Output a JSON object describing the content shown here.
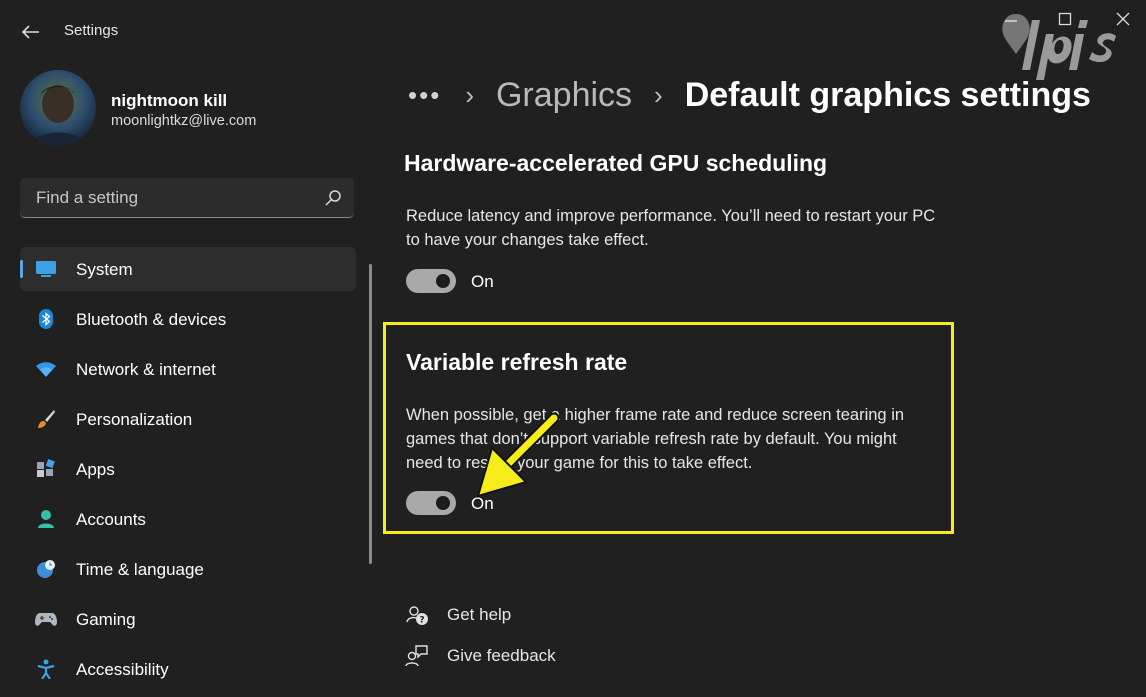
{
  "window": {
    "title": "Settings"
  },
  "profile": {
    "name": "nightmoon kill",
    "email": "moonlightkz@live.com"
  },
  "search": {
    "placeholder": "Find a setting"
  },
  "sidebar": {
    "items": [
      {
        "label": "System",
        "icon": "system-icon",
        "selected": true
      },
      {
        "label": "Bluetooth & devices",
        "icon": "bluetooth-icon"
      },
      {
        "label": "Network & internet",
        "icon": "wifi-icon"
      },
      {
        "label": "Personalization",
        "icon": "brush-icon"
      },
      {
        "label": "Apps",
        "icon": "apps-icon"
      },
      {
        "label": "Accounts",
        "icon": "account-icon"
      },
      {
        "label": "Time & language",
        "icon": "globe-clock-icon"
      },
      {
        "label": "Gaming",
        "icon": "gamepad-icon"
      },
      {
        "label": "Accessibility",
        "icon": "accessibility-icon"
      }
    ]
  },
  "breadcrumb": {
    "more": "•••",
    "parent": "Graphics",
    "current": "Default graphics settings"
  },
  "settings": {
    "gpu_scheduling": {
      "title": "Hardware-accelerated GPU scheduling",
      "description_line1": "Reduce latency and improve performance. You’ll need to restart your PC",
      "description_line2": "to have your changes take effect.",
      "state": "On"
    },
    "vrr": {
      "title": "Variable refresh rate",
      "description_line1": "When possible, get a higher frame rate and reduce screen tearing in",
      "description_line2": "games that don’t support variable refresh rate by default. You might",
      "description_line3": "need to restart your game for this to take effect.",
      "state": "On"
    }
  },
  "help": {
    "get_help": "Get help",
    "give_feedback": "Give feedback"
  },
  "colors": {
    "background": "#202020",
    "accent": "#5aa7e6",
    "highlight": "#f5ec1a",
    "toggle": "#a9a9a9"
  }
}
